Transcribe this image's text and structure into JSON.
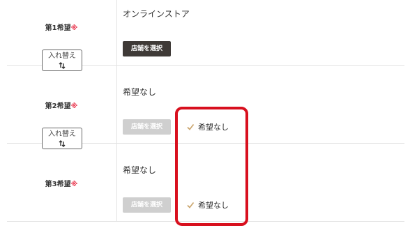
{
  "rows": [
    {
      "label": "第1希望",
      "required_mark": "※",
      "value": "オンラインストア",
      "store_button": "店舗を選択",
      "store_button_state": "active",
      "swap_button": "入れ替え"
    },
    {
      "label": "第2希望",
      "required_mark": "※",
      "value": "希望なし",
      "store_button": "店舗を選択",
      "store_button_state": "disabled",
      "checkbox_label": "希望なし",
      "checkbox_checked": true,
      "swap_button": "入れ替え"
    },
    {
      "label": "第3希望",
      "required_mark": "※",
      "value": "希望なし",
      "store_button": "店舗を選択",
      "store_button_state": "disabled",
      "checkbox_label": "希望なし",
      "checkbox_checked": true
    }
  ],
  "icons": {
    "swap": "swap-arrows-icon",
    "check": "checkmark-icon"
  },
  "colors": {
    "required": "#e8324a",
    "button_active": "#3f3a37",
    "button_disabled": "#cfcfcf",
    "check": "#c9a36a",
    "highlight": "#d8101e",
    "divider": "#e3e3e3"
  }
}
